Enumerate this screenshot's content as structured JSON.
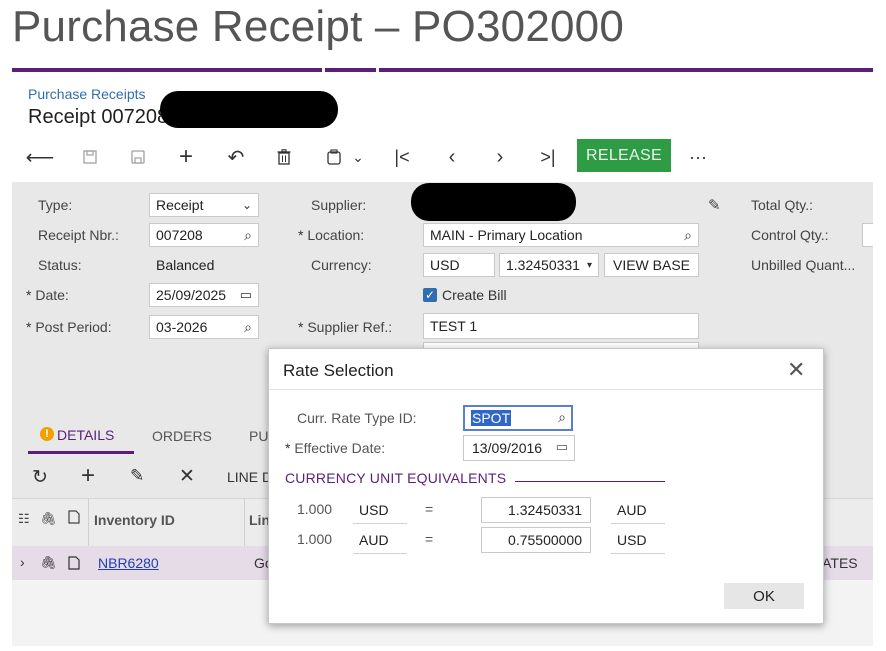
{
  "doc_title": "Purchase Receipt – PO302000",
  "header": {
    "breadcrumb": "Purchase Receipts",
    "title": "Receipt 007208",
    "release_label": "RELEASE",
    "more_label": "···"
  },
  "form": {
    "type_label": "Type:",
    "type_value": "Receipt",
    "receipt_nbr_label": "Receipt Nbr.:",
    "receipt_nbr_value": "007208",
    "status_label": "Status:",
    "status_value": "Balanced",
    "date_label": "Date:",
    "date_value": "25/09/2025",
    "post_period_label": "Post Period:",
    "post_period_value": "03-2026",
    "supplier_label": "Supplier:",
    "location_label": "Location:",
    "location_value": "MAIN - Primary Location",
    "currency_label": "Currency:",
    "currency_value": "USD",
    "rate_value": "1.32450331",
    "view_base_label": "VIEW BASE",
    "create_bill_label": "Create Bill",
    "supplier_ref_label": "Supplier Ref.:",
    "supplier_ref_value": "TEST 1",
    "total_qty_label": "Total Qty.:",
    "control_qty_label": "Control Qty.:",
    "unbilled_qty_label": "Unbilled Quant..."
  },
  "tabs": {
    "details": "DETAILS",
    "orders": "ORDERS",
    "partial": "PU"
  },
  "grid": {
    "line_partial": "LINE D",
    "col_inventory": "Inventory ID",
    "col_line_partial": "Lin",
    "row_inventory": "NBR6280",
    "row_partial": "Go",
    "row_right_partial": "RATES"
  },
  "dialog": {
    "title": "Rate Selection",
    "rate_type_label": "Curr. Rate Type ID:",
    "rate_type_value": "SPOT",
    "effective_date_label": "Effective Date:",
    "effective_date_value": "13/09/2016",
    "section_title": "CURRENCY UNIT EQUIVALENTS",
    "rows": [
      {
        "amount": "1.000",
        "from": "USD",
        "eq": "=",
        "rate": "1.32450331",
        "to": "AUD"
      },
      {
        "amount": "1.000",
        "from": "AUD",
        "eq": "=",
        "rate": "0.75500000",
        "to": "USD"
      }
    ],
    "ok_label": "OK"
  },
  "colors": {
    "accent_purple": "#5b1f7a",
    "release_green": "#2e9b45",
    "link_blue": "#2f6fb0",
    "warning_orange": "#f0a000"
  }
}
